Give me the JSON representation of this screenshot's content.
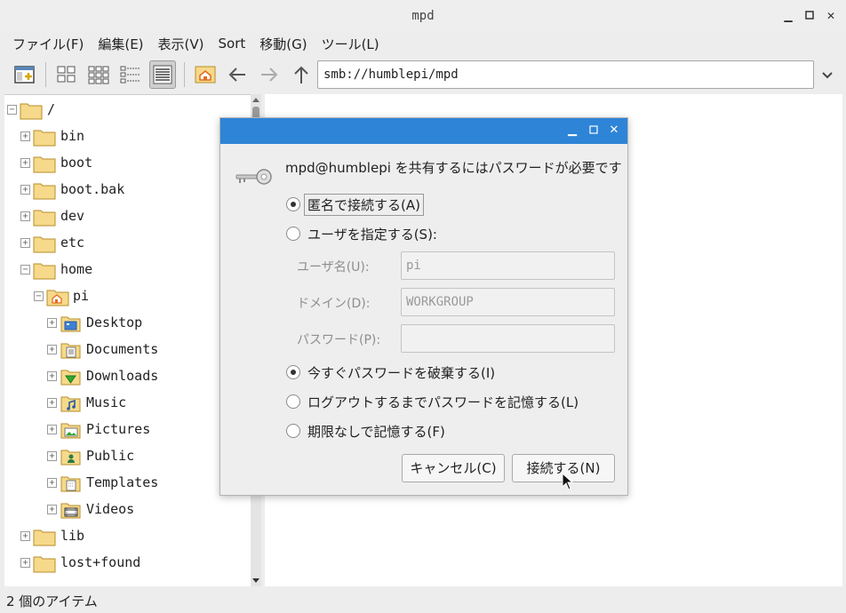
{
  "window": {
    "title": "mpd"
  },
  "menubar": [
    "ファイル(F)",
    "編集(E)",
    "表示(V)",
    "Sort",
    "移動(G)",
    "ツール(L)"
  ],
  "toolbar": {
    "address": "smb://humblepi/mpd"
  },
  "tree": {
    "items": [
      {
        "label": "/",
        "expander": "−"
      },
      {
        "label": "bin",
        "expander": "+"
      },
      {
        "label": "boot",
        "expander": "+"
      },
      {
        "label": "boot.bak",
        "expander": "+"
      },
      {
        "label": "dev",
        "expander": "+"
      },
      {
        "label": "etc",
        "expander": "+"
      },
      {
        "label": "home",
        "expander": "−"
      },
      {
        "label": "pi",
        "expander": "−"
      },
      {
        "label": "Desktop",
        "expander": "+"
      },
      {
        "label": "Documents",
        "expander": "+"
      },
      {
        "label": "Downloads",
        "expander": "+"
      },
      {
        "label": "Music",
        "expander": "+"
      },
      {
        "label": "Pictures",
        "expander": "+"
      },
      {
        "label": "Public",
        "expander": "+"
      },
      {
        "label": "Templates",
        "expander": "+"
      },
      {
        "label": "Videos",
        "expander": "+"
      },
      {
        "label": "lib",
        "expander": "+"
      },
      {
        "label": "lost+found",
        "expander": "+"
      }
    ]
  },
  "status": {
    "text": "2 個のアイテム"
  },
  "dialog": {
    "message": "mpd@humblepi を共有するにはパスワードが必要です",
    "radio_anonymous": "匿名で接続する(A)",
    "radio_user": "ユーザを指定する(S):",
    "username_label": "ユーザ名(U):",
    "username_value": "pi",
    "domain_label": "ドメイン(D):",
    "domain_value": "WORKGROUP",
    "password_label": "パスワード(P):",
    "password_value": "",
    "radio_forget": "今すぐパスワードを破棄する(I)",
    "radio_until_logout": "ログアウトするまでパスワードを記憶する(L)",
    "radio_forever": "期限なしで記憶する(F)",
    "cancel_label": "キャンセル(C)",
    "connect_label": "接続する(N)"
  },
  "colors": {
    "dialog_titlebar": "#2e84d6",
    "folder": "#f6d98a",
    "home_accent": "#e46b1c"
  }
}
